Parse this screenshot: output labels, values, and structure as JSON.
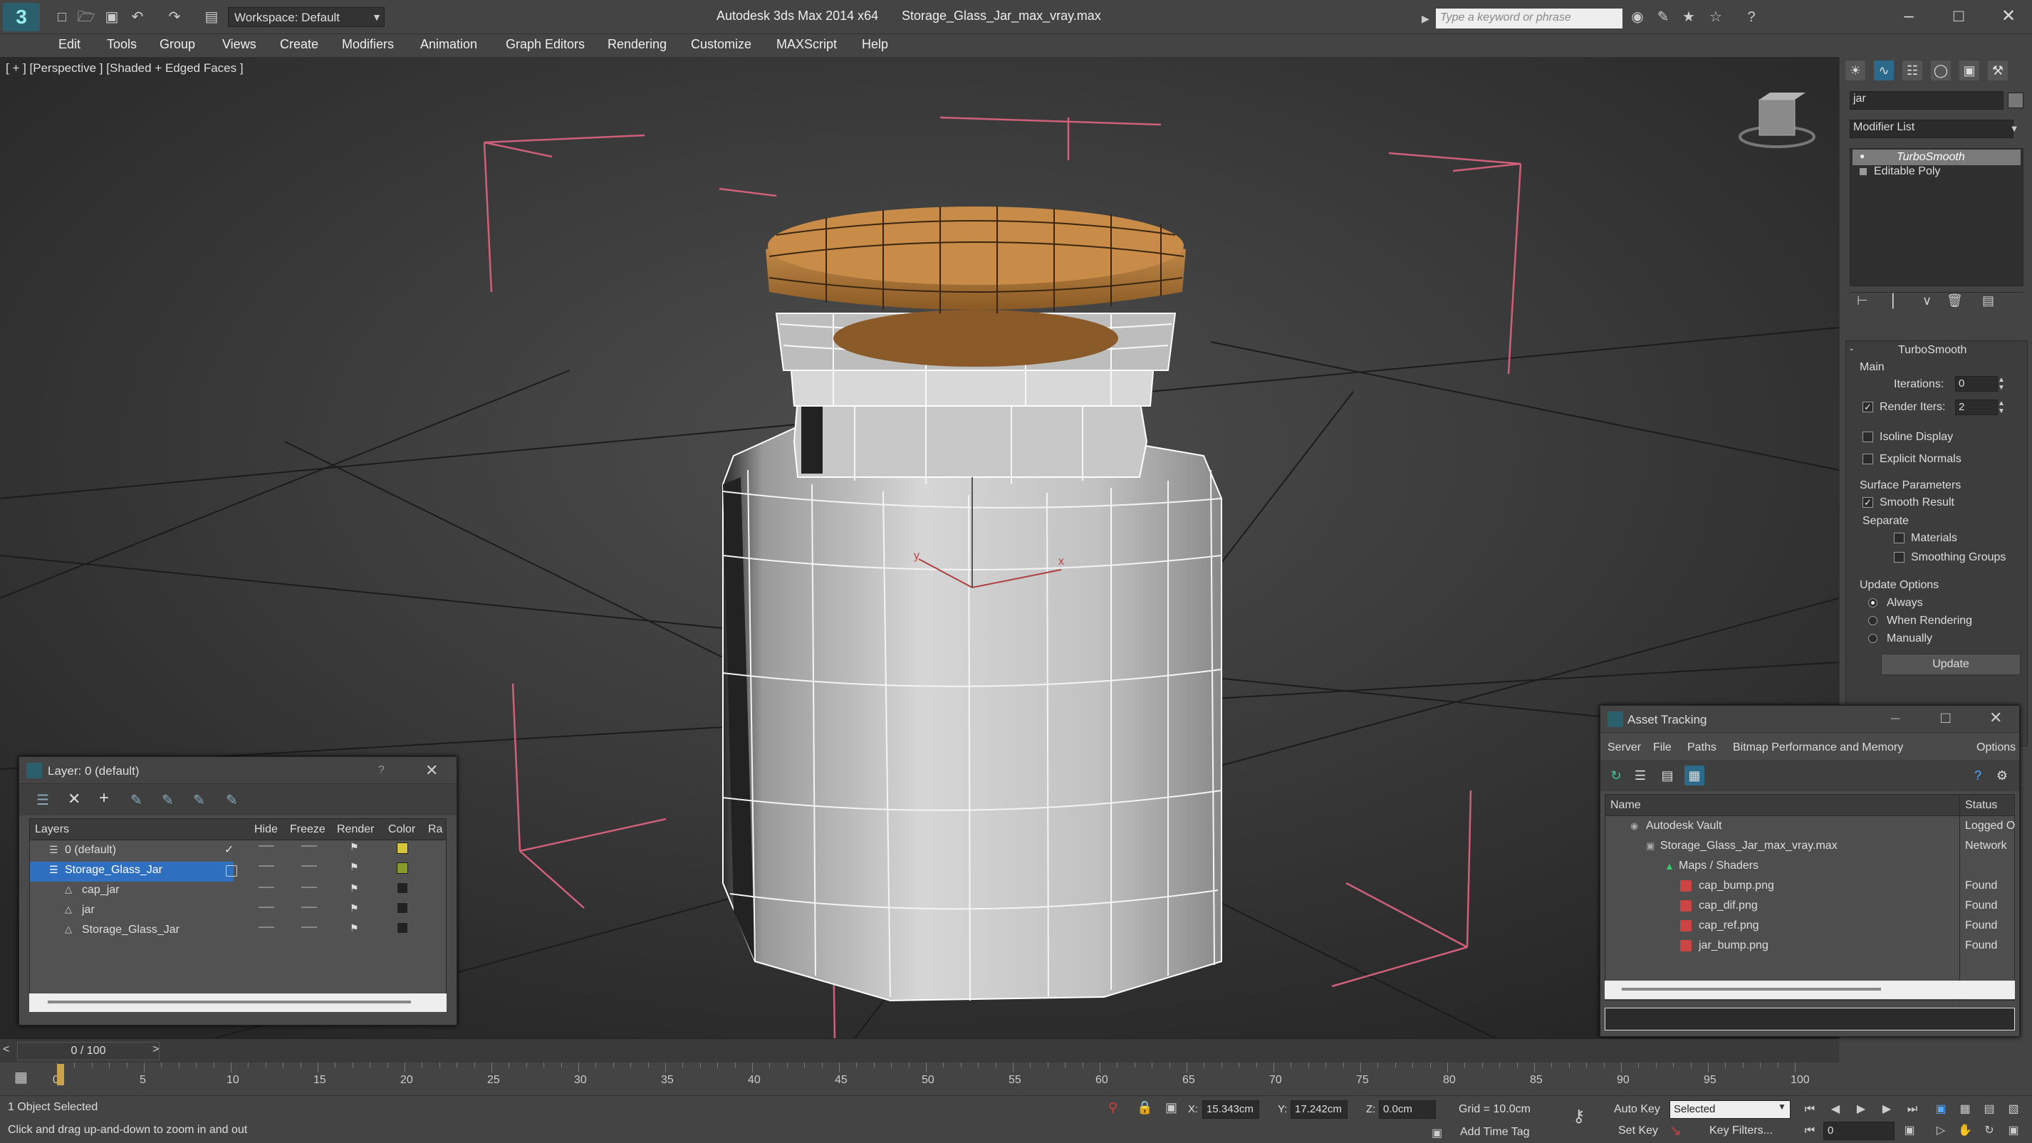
{
  "app": {
    "title": "Autodesk 3ds Max  2014 x64",
    "file": "Storage_Glass_Jar_max_vray.max",
    "workspace": "Workspace: Default",
    "search_placeholder": "Type a keyword or phrase"
  },
  "menu": [
    "Edit",
    "Tools",
    "Group",
    "Views",
    "Create",
    "Modifiers",
    "Animation",
    "Graph Editors",
    "Rendering",
    "Customize",
    "MAXScript",
    "Help"
  ],
  "viewport": {
    "label": "[ + ] [Perspective ] [Shaded + Edged Faces ]",
    "gizmo_x": "x",
    "gizmo_y": "y"
  },
  "command_panel": {
    "object_name": "jar",
    "modifier_list": "Modifier List",
    "stack": [
      "TurboSmooth",
      "Editable Poly"
    ],
    "rollout_title": "TurboSmooth",
    "main_label": "Main",
    "iterations_label": "Iterations:",
    "iterations_value": "0",
    "render_iters_label": "Render Iters:",
    "render_iters_value": "2",
    "isoline_label": "Isoline Display",
    "explicit_normals_label": "Explicit Normals",
    "surface_params_label": "Surface Parameters",
    "smooth_result_label": "Smooth Result",
    "separate_label": "Separate",
    "materials_label": "Materials",
    "smoothing_groups_label": "Smoothing Groups",
    "update_options_label": "Update Options",
    "always_label": "Always",
    "when_rendering_label": "When Rendering",
    "manually_label": "Manually",
    "update_button": "Update"
  },
  "layer_dialog": {
    "title": "Layer: 0 (default)",
    "help": "?",
    "columns": [
      "Layers",
      "Hide",
      "Freeze",
      "Render",
      "Color",
      "Ra"
    ],
    "rows": [
      {
        "name": "0 (default)",
        "color": "#d4c43a"
      },
      {
        "name": "Storage_Glass_Jar",
        "color": "#8a9a2a"
      },
      {
        "name": "cap_jar",
        "color": "#222222"
      },
      {
        "name": "jar",
        "color": "#222222"
      },
      {
        "name": "Storage_Glass_Jar",
        "color": "#222222"
      }
    ]
  },
  "asset_tracking": {
    "title": "Asset Tracking",
    "menu": [
      "Server",
      "File",
      "Paths",
      "Bitmap Performance and Memory",
      "Options"
    ],
    "columns": [
      "Name",
      "Status"
    ],
    "rows": [
      {
        "name": "Autodesk Vault",
        "status": "Logged O"
      },
      {
        "name": "Storage_Glass_Jar_max_vray.max",
        "status": "Network"
      },
      {
        "name": "Maps / Shaders",
        "status": ""
      },
      {
        "name": "cap_bump.png",
        "status": "Found"
      },
      {
        "name": "cap_dif.png",
        "status": "Found"
      },
      {
        "name": "cap_ref.png",
        "status": "Found"
      },
      {
        "name": "jar_bump.png",
        "status": "Found"
      }
    ]
  },
  "timeline": {
    "frame": "0 / 100",
    "ticks": [
      "0",
      "5",
      "10",
      "15",
      "20",
      "25",
      "30",
      "35",
      "40",
      "45",
      "50",
      "55",
      "60",
      "65",
      "70",
      "75",
      "80",
      "85",
      "90",
      "95",
      "100"
    ]
  },
  "status": {
    "selection": "1 Object Selected",
    "prompt": "Click and drag up-and-down to zoom in and out",
    "x_label": "X:",
    "x_value": "15.343cm",
    "y_label": "Y:",
    "y_value": "17.242cm",
    "z_label": "Z:",
    "z_value": "0.0cm",
    "grid": "Grid = 10.0cm",
    "add_time_tag": "Add Time Tag",
    "auto_key": "Auto Key",
    "set_key": "Set Key",
    "selected": "Selected",
    "key_filters": "Key Filters...",
    "current_frame": "0"
  }
}
